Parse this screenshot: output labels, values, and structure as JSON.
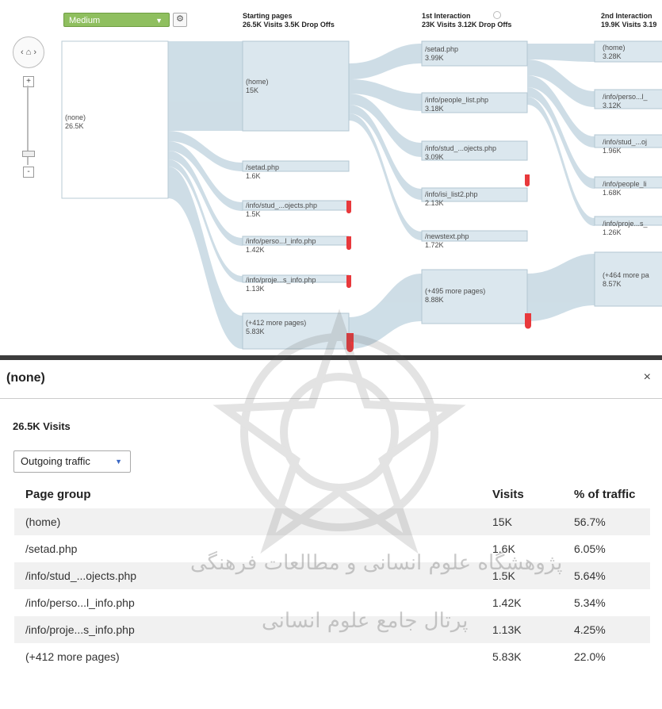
{
  "flow": {
    "dimension_select": "Medium",
    "columns": [
      {
        "title": "Starting pages",
        "stats": "26.5K Visits 3.5K Drop Offs"
      },
      {
        "title": "1st Interaction",
        "stats": "23K Visits 3.12K Drop Offs"
      },
      {
        "title": "2nd Interaction",
        "stats": "19.9K Visits 3.19"
      }
    ],
    "source_node": {
      "label": "(none)",
      "value": "26.5K"
    },
    "starting_pages": [
      {
        "label": "(home)",
        "value": "15K"
      },
      {
        "label": "/setad.php",
        "value": "1.6K"
      },
      {
        "label": "/info/stud_...ojects.php",
        "value": "1.5K"
      },
      {
        "label": "/info/perso...l_info.php",
        "value": "1.42K"
      },
      {
        "label": "/info/proje...s_info.php",
        "value": "1.13K"
      },
      {
        "label": "(+412 more pages)",
        "value": "5.83K"
      }
    ],
    "first_interaction": [
      {
        "label": "/setad.php",
        "value": "3.99K"
      },
      {
        "label": "/info/people_list.php",
        "value": "3.18K"
      },
      {
        "label": "/info/stud_...ojects.php",
        "value": "3.09K"
      },
      {
        "label": "/info/isi_list2.php",
        "value": "2.13K"
      },
      {
        "label": "/newstext.php",
        "value": "1.72K"
      },
      {
        "label": "(+495 more pages)",
        "value": "8.88K"
      }
    ],
    "second_interaction": [
      {
        "label": "(home)",
        "value": "3.28K"
      },
      {
        "label": "/info/perso...l_",
        "value": "3.12K"
      },
      {
        "label": "/info/stud_...oj",
        "value": "1.96K"
      },
      {
        "label": "/info/people_li",
        "value": "1.68K"
      },
      {
        "label": "/info/proje...s_",
        "value": "1.26K"
      },
      {
        "label": "(+464 more pa",
        "value": "8.57K"
      }
    ]
  },
  "detail": {
    "title": "(none)",
    "close_glyph": "×",
    "visits": "26.5K Visits",
    "traffic_dropdown": "Outgoing traffic",
    "columns": [
      "Page group",
      "Visits",
      "% of traffic"
    ],
    "rows": [
      {
        "page": "(home)",
        "visits": "15K",
        "pct": "56.7%"
      },
      {
        "page": "/setad.php",
        "visits": "1.6K",
        "pct": "6.05%"
      },
      {
        "page": "/info/stud_...ojects.php",
        "visits": "1.5K",
        "pct": "5.64%"
      },
      {
        "page": "/info/perso...l_info.php",
        "visits": "1.42K",
        "pct": "5.34%"
      },
      {
        "page": "/info/proje...s_info.php",
        "visits": "1.13K",
        "pct": "4.25%"
      },
      {
        "page": "(+412 more pages)",
        "visits": "5.83K",
        "pct": "22.0%"
      }
    ]
  },
  "watermark": {
    "line1": "پژوهشگاه علوم انسانی و مطالعات فرهنگی",
    "line2": "پرتال جامع علوم انسانی"
  },
  "colors": {
    "node_fill": "#dce8ef",
    "node_edge": "#9db6c6",
    "flow_fill": "#c7d8e2",
    "drop_off": "#e8393c",
    "dimension_green": "#8fbf5f",
    "row_shade": "#f1f1f1"
  }
}
